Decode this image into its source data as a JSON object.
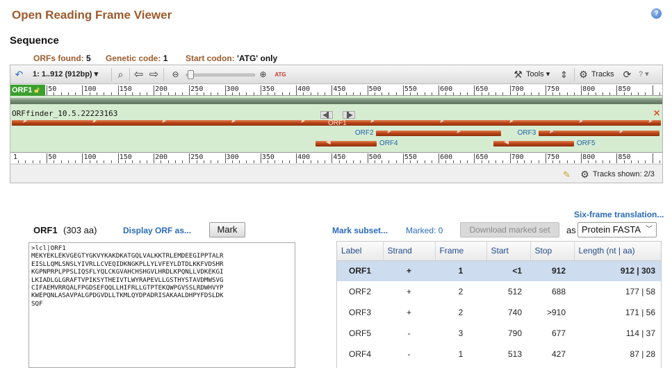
{
  "app": {
    "title": "Open Reading Frame Viewer",
    "help_glyph": "?"
  },
  "sequence": {
    "heading": "Sequence",
    "orfs_found_label": "ORFs found:",
    "orfs_found_value": "5",
    "genetic_code_label": "Genetic code:",
    "genetic_code_value": "1",
    "start_codon_label": "Start codon:",
    "start_codon_value": "'ATG' only"
  },
  "toolbar": {
    "range": "1: 1..912 (912bp)",
    "tools_label": "Tools",
    "tracks_label": "Tracks"
  },
  "ruler": {
    "badge": "ORF1",
    "top_ticks": [
      "50",
      "100",
      "150",
      "200",
      "250",
      "300",
      "350",
      "400",
      "450",
      "500",
      "550",
      "600",
      "650",
      "700",
      "750",
      "800",
      "850"
    ],
    "bottom_ticks": [
      "1",
      "50",
      "100",
      "150",
      "200",
      "250",
      "300",
      "350",
      "400",
      "450",
      "500",
      "550",
      "600",
      "650",
      "700",
      "750",
      "800",
      "850"
    ],
    "seq_length": 912
  },
  "track": {
    "name": "ORFfinder_10.5.22223163",
    "orfs": [
      {
        "label": "ORF1",
        "start": 1,
        "stop": 912,
        "strand": "+",
        "row": 0
      },
      {
        "label": "ORF2",
        "start": 512,
        "stop": 688,
        "strand": "+",
        "row": 1
      },
      {
        "label": "ORF3",
        "start": 740,
        "stop": 910,
        "strand": "+",
        "row": 1
      },
      {
        "label": "ORF4",
        "start": 427,
        "stop": 513,
        "strand": "-",
        "row": 2
      },
      {
        "label": "ORF5",
        "start": 677,
        "stop": 790,
        "strand": "-",
        "row": 2
      }
    ]
  },
  "footer": {
    "tracks_shown": "Tracks shown: 2/3"
  },
  "colors": {
    "accent": "#9c5a2b",
    "link": "#2a6bb8",
    "orf_bar": "#b74216",
    "track_bg": "#d6ecd1"
  },
  "detail": {
    "six_frame_link": "Six-frame translation...",
    "orf_name": "ORF1",
    "orf_length": "(303 aa)",
    "display_link": "Display ORF as...",
    "mark_button": "Mark",
    "fasta": ">lcl|ORF1\nMEKYEKLEKVGEGTYGKVYKAKDKATGQLVALKKTRLEMDEEGIPPTALR\nEISLLQMLSNSLYIVRLLCVEQIDKNGKPLLYLVFEYLDTDLKKFVDSHR\nKGPNPRPLPPSLIQSFLYQLCKGVAHCHSHGVLHRDLKPQNLLVDKEKGI\nLKIADLGLGRAFTVPIKSYTHEIVTLWYRAPEVLLGSTHYSTAVDMWSVG\nCIFAEMVRRQALFPGDSEFQQLLHIFRLLGTPTEKQWPGVSSLRDWHVYP\nKWEPQNLASAVPALGPDGVDLLTKMLQYDPADRISAKAALDHPYFDSLDK\nSQF"
  },
  "table": {
    "mark_subset_link": "Mark subset...",
    "marked": "Marked: 0",
    "download_button": "Download marked set",
    "as_label": "as",
    "format": "Protein FASTA",
    "columns": [
      "Label",
      "Strand",
      "Frame",
      "Start",
      "Stop",
      "Length (nt | aa)"
    ],
    "rows": [
      {
        "label": "ORF1",
        "strand": "+",
        "frame": "1",
        "start": "<1",
        "stop": "912",
        "length": "912 | 303"
      },
      {
        "label": "ORF2",
        "strand": "+",
        "frame": "2",
        "start": "512",
        "stop": "688",
        "length": "177 | 58"
      },
      {
        "label": "ORF3",
        "strand": "+",
        "frame": "2",
        "start": "740",
        "stop": ">910",
        "length": "171 | 56"
      },
      {
        "label": "ORF5",
        "strand": "-",
        "frame": "3",
        "start": "790",
        "stop": "677",
        "length": "114 | 37"
      },
      {
        "label": "ORF4",
        "strand": "-",
        "frame": "1",
        "start": "513",
        "stop": "427",
        "length": "87 | 28"
      }
    ]
  }
}
